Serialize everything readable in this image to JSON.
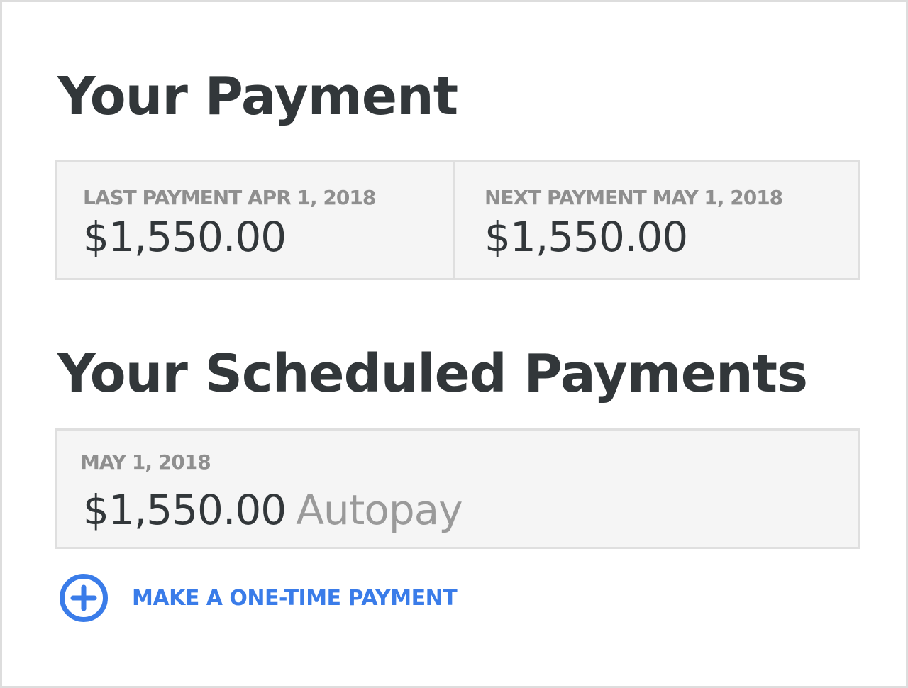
{
  "header": {
    "title": "Your Payment"
  },
  "payment_summary": {
    "last": {
      "label": "LAST PAYMENT APR 1, 2018",
      "amount": "$1,550.00"
    },
    "next": {
      "label": "NEXT PAYMENT MAY 1, 2018",
      "amount": "$1,550.00"
    }
  },
  "scheduled": {
    "title": "Your Scheduled Payments",
    "items": [
      {
        "date": "MAY 1, 2018",
        "amount": "$1,550.00",
        "method": "Autopay"
      }
    ]
  },
  "actions": {
    "one_time_payment": {
      "label": "MAKE A ONE-TIME PAYMENT",
      "icon": "plus-circle-icon"
    }
  },
  "colors": {
    "text_dark": "#32373a",
    "text_muted": "#8f8f8f",
    "card_background": "#f5f5f5",
    "card_border": "#dfdfdf",
    "accent_blue": "#3a7ce9"
  }
}
